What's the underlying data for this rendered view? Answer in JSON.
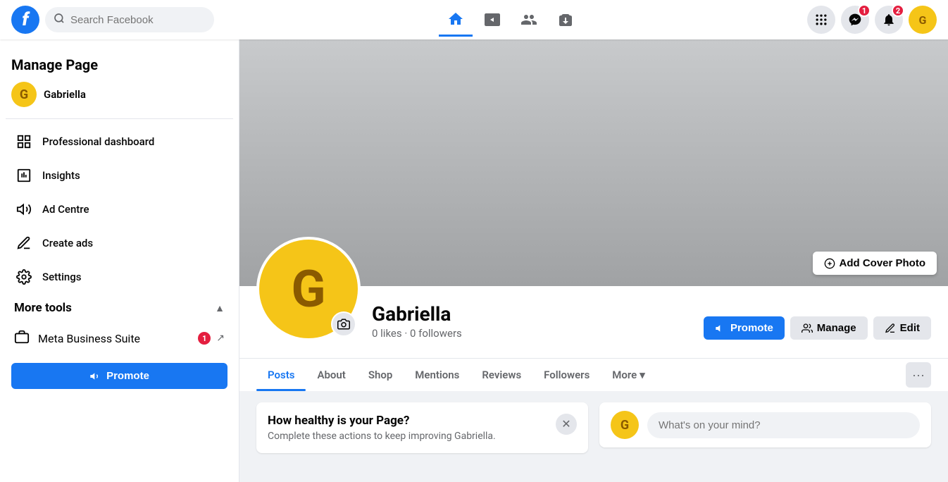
{
  "topnav": {
    "logo_letter": "f",
    "search_placeholder": "Search Facebook",
    "nav_icons": [
      {
        "name": "home-icon",
        "symbol": "⌂",
        "active": true
      },
      {
        "name": "video-icon",
        "symbol": "▶",
        "active": false
      },
      {
        "name": "people-icon",
        "symbol": "👥",
        "active": false
      },
      {
        "name": "market-icon",
        "symbol": "⊞",
        "active": false
      }
    ],
    "grid_icon": "⊞",
    "messenger_badge": "1",
    "notif_badge": "2",
    "profile_letter": "G"
  },
  "sidebar": {
    "title": "Manage Page",
    "user_letter": "G",
    "user_name": "Gabriella",
    "items": [
      {
        "name": "professional-dashboard-item",
        "icon": "📊",
        "label": "Professional dashboard"
      },
      {
        "name": "insights-item",
        "icon": "📋",
        "label": "Insights"
      },
      {
        "name": "ad-centre-item",
        "icon": "📢",
        "label": "Ad Centre"
      },
      {
        "name": "create-ads-item",
        "icon": "✏️",
        "label": "Create ads"
      },
      {
        "name": "settings-item",
        "icon": "⚙️",
        "label": "Settings"
      }
    ],
    "more_tools_label": "More tools",
    "meta_item_label": "Meta Business Suite",
    "meta_badge": "1",
    "promote_label": "Promote",
    "promote_icon": "📢"
  },
  "cover": {
    "add_cover_label": "Add Cover Photo",
    "camera_icon": "📷"
  },
  "profile": {
    "letter": "G",
    "name": "Gabriella",
    "stats": "0 likes · 0 followers",
    "camera_icon": "📷"
  },
  "actions": {
    "promote_label": "Promote",
    "promote_icon": "📢",
    "manage_label": "Manage",
    "manage_icon": "🤝",
    "edit_label": "Edit",
    "edit_icon": "✏️"
  },
  "tabs": [
    {
      "name": "tab-posts",
      "label": "Posts",
      "active": true
    },
    {
      "name": "tab-about",
      "label": "About",
      "active": false
    },
    {
      "name": "tab-shop",
      "label": "Shop",
      "active": false
    },
    {
      "name": "tab-mentions",
      "label": "Mentions",
      "active": false
    },
    {
      "name": "tab-reviews",
      "label": "Reviews",
      "active": false
    },
    {
      "name": "tab-followers",
      "label": "Followers",
      "active": false
    },
    {
      "name": "tab-more",
      "label": "More",
      "active": false
    }
  ],
  "health_card": {
    "title": "How healthy is your Page?",
    "description": "Complete these actions to keep improving Gabriella."
  },
  "post_box": {
    "letter": "G",
    "placeholder": "What's on your mind?"
  }
}
